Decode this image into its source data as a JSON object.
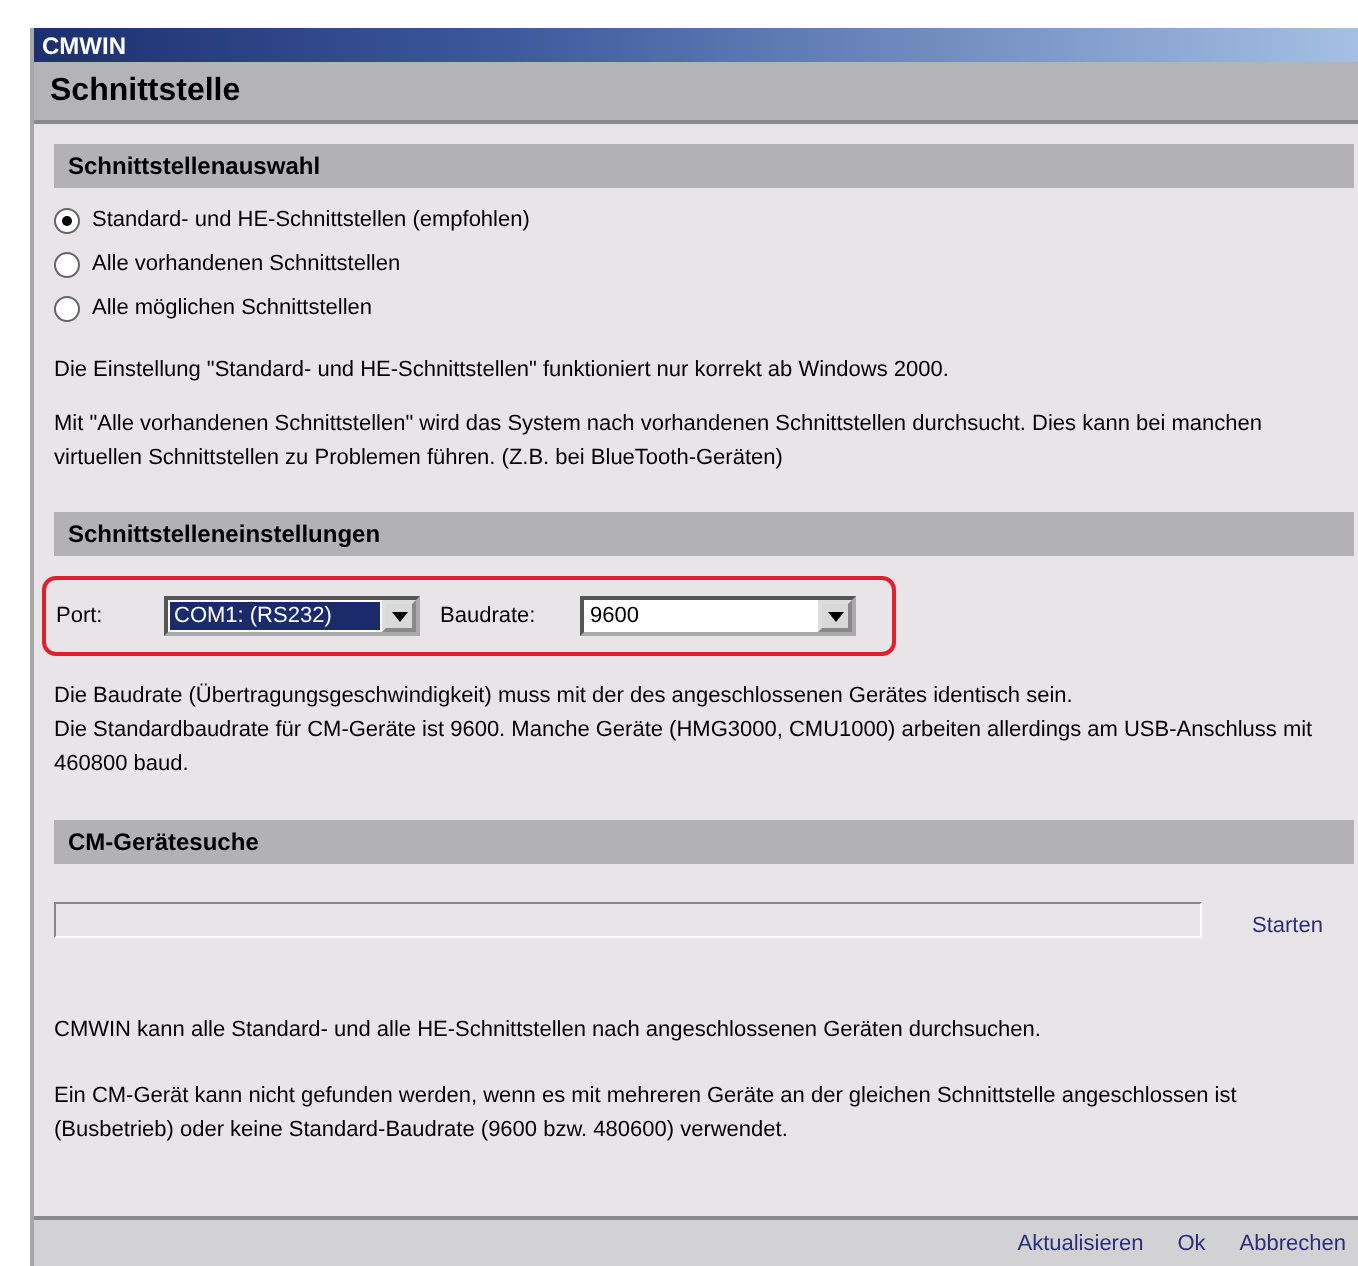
{
  "window": {
    "title": "CMWIN"
  },
  "page_title": "Schnittstelle",
  "sections": [
    {
      "heading": "Schnittstellenauswahl",
      "kind": "selection",
      "options": [
        {
          "label": "Standard- und HE-Schnittstellen (empfohlen)",
          "selected": true
        },
        {
          "label": "Alle vorhandenen Schnittstellen",
          "selected": false
        },
        {
          "label": "Alle möglichen Schnittstellen",
          "selected": false
        }
      ],
      "paragraphs": [
        "Die Einstellung \"Standard- und HE-Schnittstellen\" funktioniert nur korrekt ab Windows 2000.",
        "Mit \"Alle vorhandenen Schnittstellen\" wird das System nach vorhandenen Schnittstellen durchsucht. Dies kann bei manchen virtuellen Schnittstellen zu Problemen führen. (Z.B. bei BlueTooth-Geräten)"
      ]
    },
    {
      "heading": "Schnittstelleneinstellungen",
      "kind": "settings",
      "fields": [
        {
          "label": "Port:",
          "value": "COM1: (RS232)",
          "focused": true
        },
        {
          "label": "Baudrate:",
          "value": "9600",
          "focused": false
        }
      ],
      "paragraphs": [
        "Die Baudrate (Übertragungsgeschwindigkeit) muss mit der des angeschlossenen Gerätes identisch sein.\nDie Standardbaudrate für CM-Geräte ist 9600. Manche Geräte (HMG3000, CMU1000) arbeiten allerdings am USB-Anschluss mit 460800 baud."
      ]
    },
    {
      "heading": "CM-Gerätesuche",
      "kind": "search",
      "progress": {
        "level": 0
      },
      "action": "Starten",
      "paragraphs": [
        "CMWIN kann alle Standard- und alle HE-Schnittstellen nach angeschlossenen Geräten durchsuchen.",
        "Ein CM-Gerät kann nicht gefunden werden, wenn es mit mehreren Geräte an der gleichen Schnittstelle angeschlossen ist (Busbetrieb) oder keine Standard-Baudrate (9600 bzw. 480600) verwendet."
      ]
    }
  ],
  "footer_buttons": [
    "Aktualisieren",
    "Ok",
    "Abbrechen"
  ]
}
